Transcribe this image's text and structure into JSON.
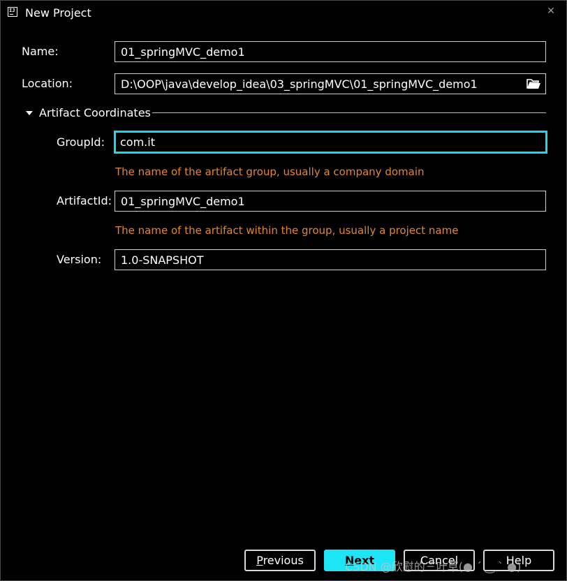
{
  "window": {
    "title": "New Project",
    "close_glyph": "✕",
    "app_icon_text": "IJ"
  },
  "form": {
    "name": {
      "label": "Name:",
      "value": "01_springMVC_demo1"
    },
    "location": {
      "label": "Location:",
      "value": "D:\\OOP\\java\\develop_idea\\03_springMVC\\01_springMVC_demo1"
    },
    "section": {
      "label": "Artifact Coordinates",
      "expanded": true
    },
    "group_id": {
      "label": "GroupId:",
      "value": "com.it",
      "hint": "The name of the artifact group, usually a company domain"
    },
    "artifact_id": {
      "label": "ArtifactId:",
      "value": "01_springMVC_demo1",
      "hint": "The name of the artifact within the group, usually a project name"
    },
    "version": {
      "label": "Version:",
      "value": "1.0-SNAPSHOT"
    }
  },
  "buttons": {
    "previous": {
      "mnemonic": "P",
      "rest": "revious"
    },
    "next": {
      "mnemonic": "N",
      "rest": "ext"
    },
    "cancel": {
      "label": "Cancel"
    },
    "help": {
      "label": "Help"
    }
  },
  "watermark": "CSDN @欣慰的三叶草(● ´ ‿ ` ●)",
  "colors": {
    "background": "#000000",
    "focus_border": "#22d4ec",
    "primary_button": "#1de5f5",
    "hint_text": "#e2862d"
  }
}
